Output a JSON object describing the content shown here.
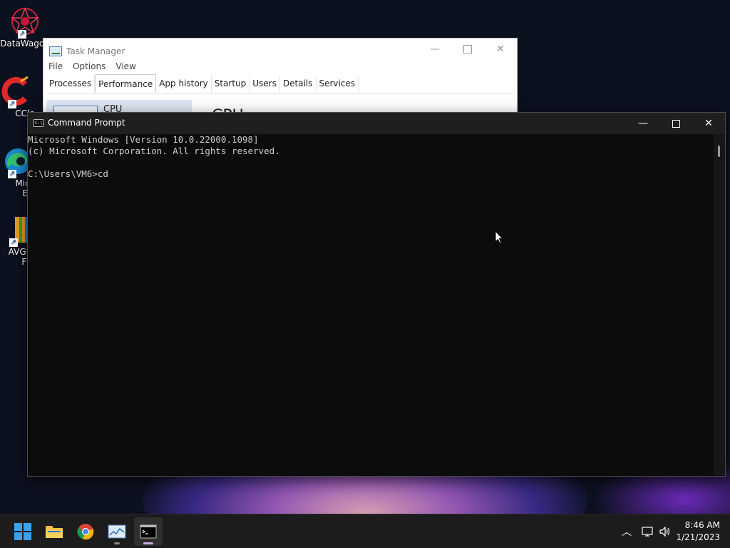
{
  "desktop": {
    "icons": [
      {
        "label": "DataWagon",
        "icon": "datawagon-icon"
      },
      {
        "label": "CCle",
        "icon": "ccleaner-icon"
      },
      {
        "label": "Micr\nEd",
        "line1": "Micr",
        "line2": "Ed",
        "icon": "edge-icon"
      },
      {
        "label": "AVG An\nFR",
        "line1": "AVG An",
        "line2": "FR",
        "icon": "avg-icon"
      }
    ]
  },
  "task_manager": {
    "title": "Task Manager",
    "menu": [
      "File",
      "Options",
      "View"
    ],
    "tabs": [
      "Processes",
      "Performance",
      "App history",
      "Startup",
      "Users",
      "Details",
      "Services"
    ],
    "active_tab": "Performance",
    "cpu_tile_label": "CPU",
    "cpu_heading": "CPU"
  },
  "command_prompt": {
    "title": "Command Prompt",
    "lines": [
      "Microsoft Windows [Version 10.0.22000.1098]",
      "(c) Microsoft Corporation. All rights reserved.",
      "",
      "C:\\Users\\VM6>cd"
    ]
  },
  "taskbar": {
    "apps": [
      "start-icon",
      "file-explorer-icon",
      "chrome-icon",
      "task-manager-icon",
      "command-prompt-icon"
    ],
    "clock": {
      "time": "8:46 AM",
      "date": "1/21/2023"
    }
  },
  "colors": {
    "console_bg": "#0c0c0c",
    "console_text": "#cccccc",
    "taskbar_bg": "#1c1c1c",
    "accent": "#0078d4"
  }
}
